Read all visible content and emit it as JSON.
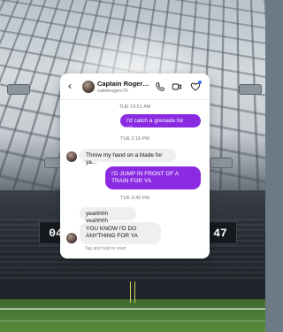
{
  "scoreboard": {
    "left": "04",
    "right": "47"
  },
  "chat": {
    "header": {
      "name": "Captain Rogers...",
      "handle": "zalebrogers76"
    },
    "timestamps": [
      "TUE 10:51 AM",
      "TUE 2:16 PM",
      "TUE 3:40 PM"
    ],
    "messages": [
      {
        "from": "me",
        "text": "I'd catch a grenade for ya..."
      },
      {
        "from": "them",
        "text": "Throw my hand on a blade for ya..."
      },
      {
        "from": "me",
        "text": "I'D JUMP IN FRONT OF A TRAIN FOR YA"
      },
      {
        "from": "them",
        "text": "yeahhhh yeahhhh"
      },
      {
        "from": "them",
        "text": "YOU KNOW I'D DO ANYTHING FOR YA"
      }
    ],
    "hint": "Tap and hold to react",
    "colors": {
      "sent_bubble": "#8a2be2",
      "received_bubble": "#efefef"
    },
    "icons": [
      "back-icon",
      "phone-icon",
      "video-icon",
      "heart-icon"
    ]
  }
}
